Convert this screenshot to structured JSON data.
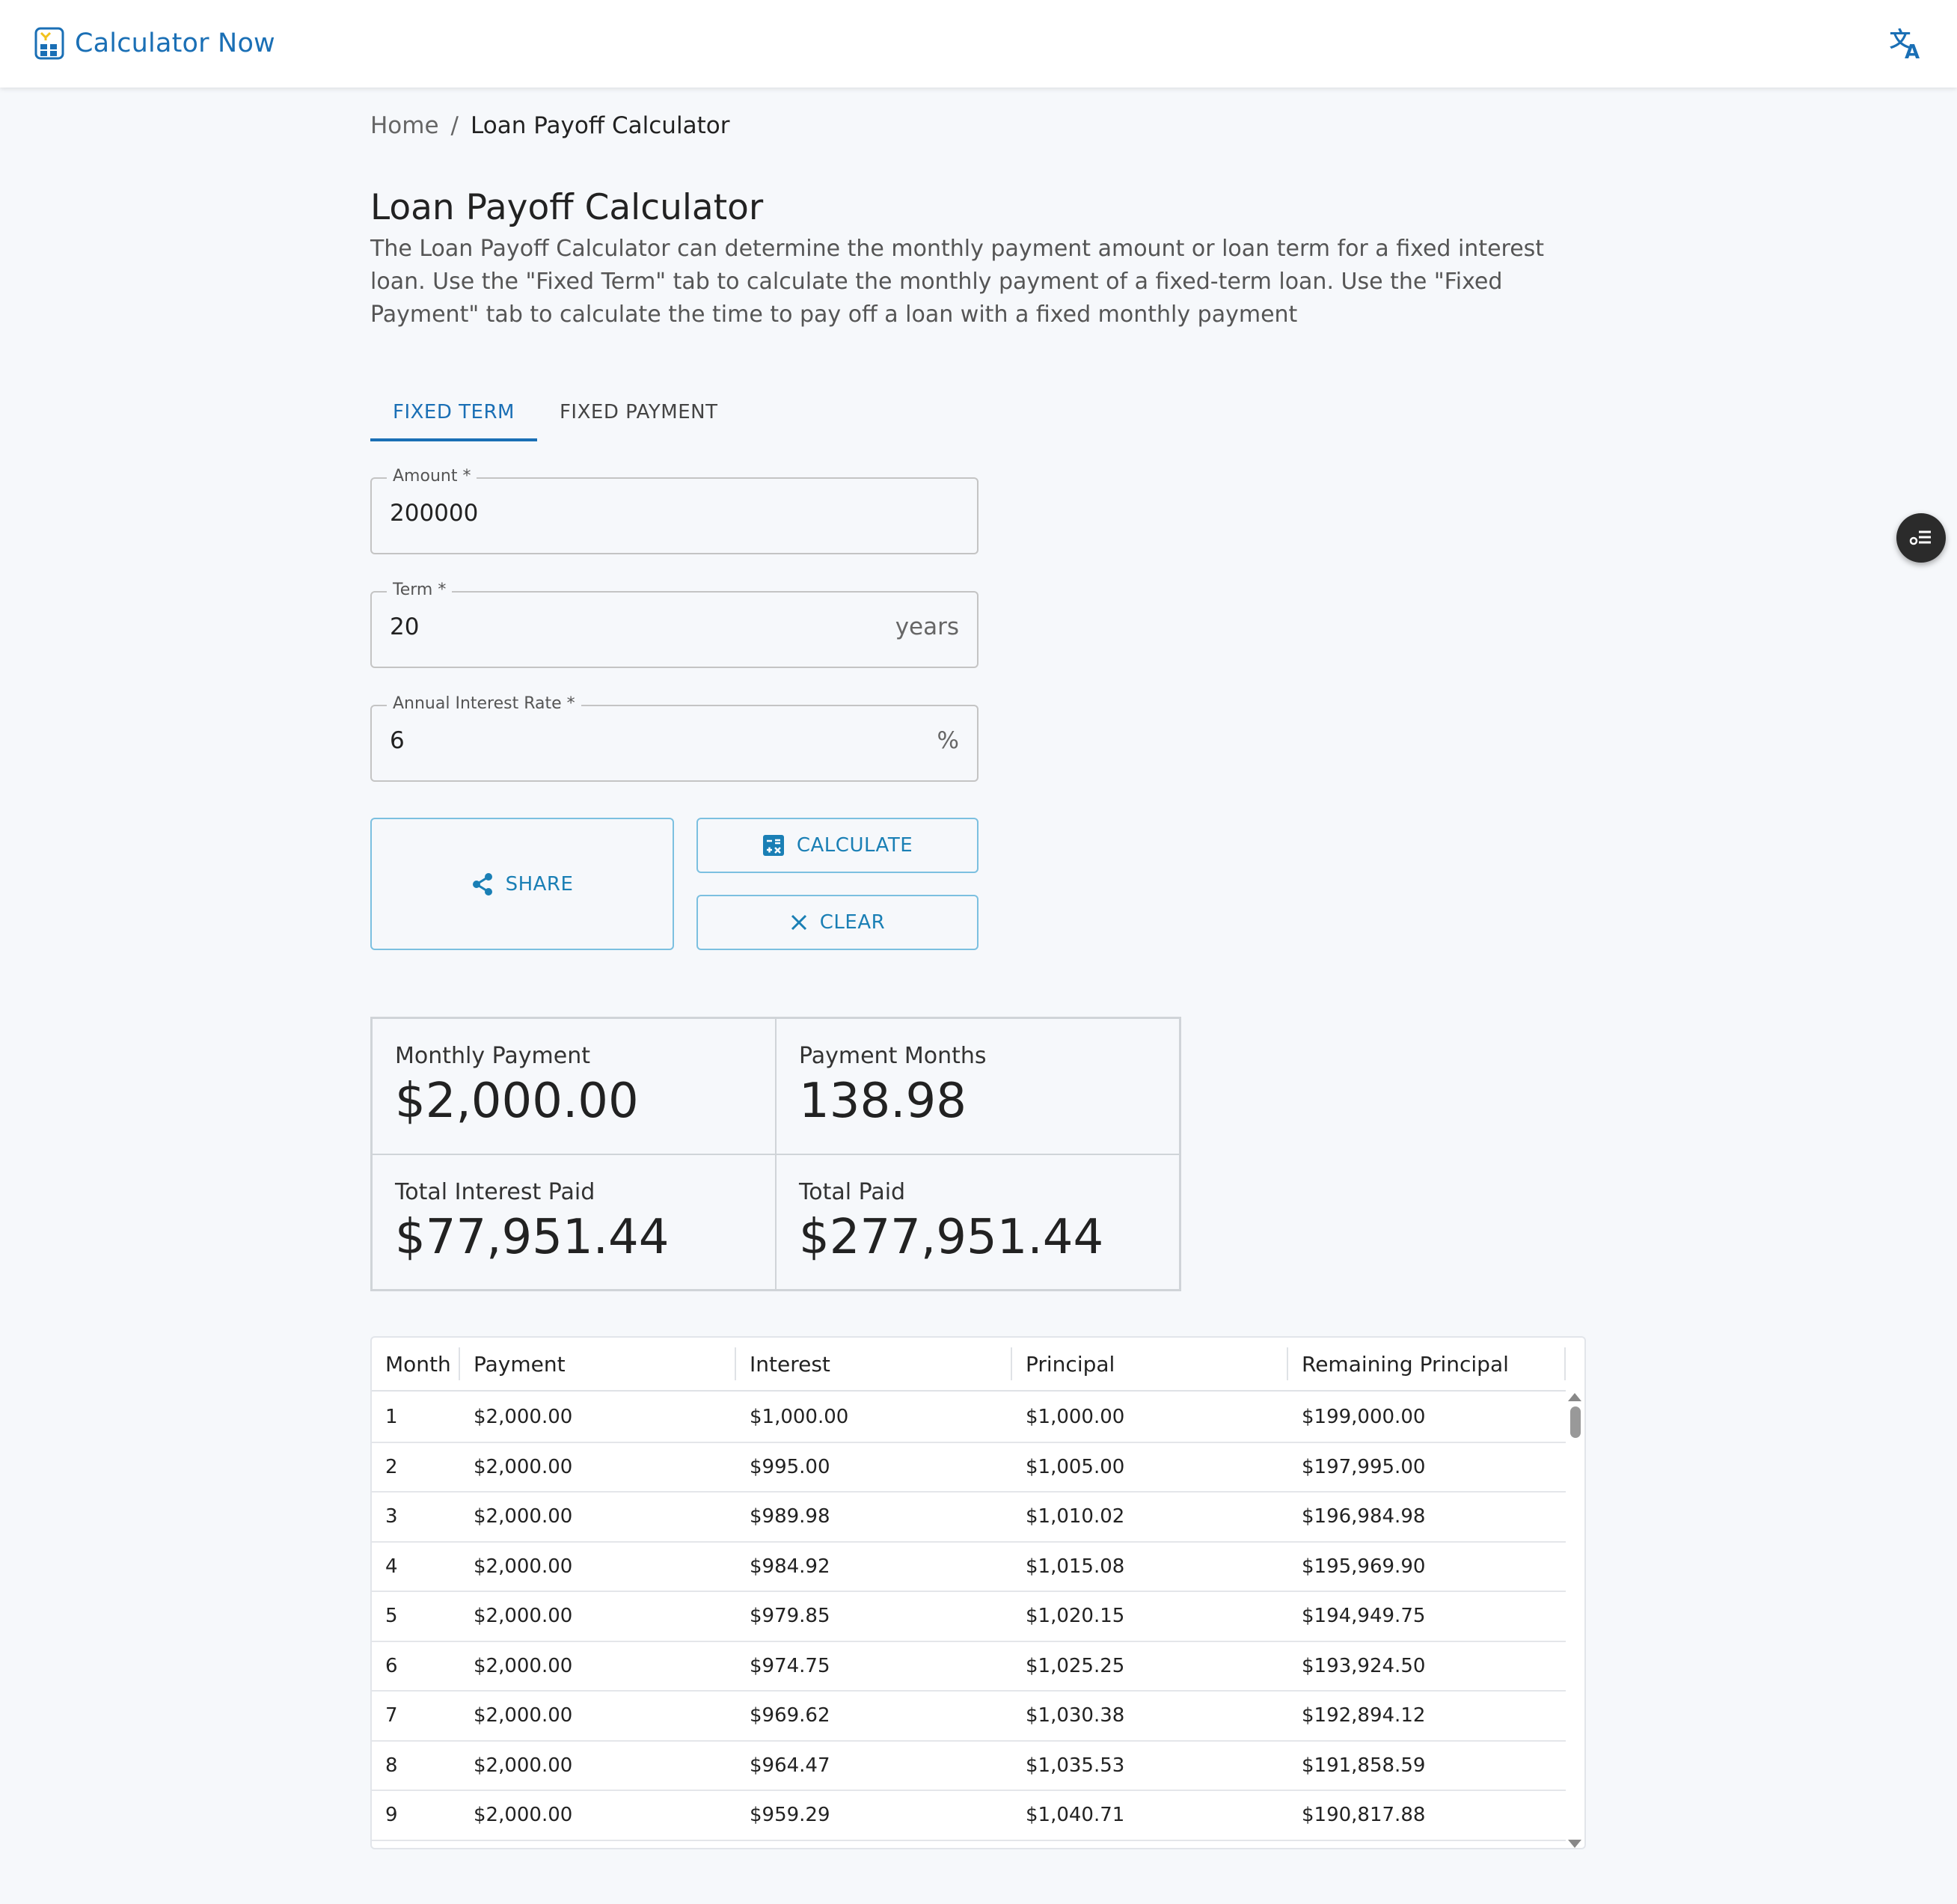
{
  "app": {
    "name": "Calculator Now",
    "accent": "#1a6fb5",
    "icons": [
      "calculator-logo-icon",
      "translate-icon",
      "share-icon",
      "calculator-icon",
      "close-icon",
      "toc-icon"
    ]
  },
  "breadcrumb": {
    "home": "Home",
    "separator": "/",
    "current": "Loan Payoff Calculator"
  },
  "page": {
    "title": "Loan Payoff Calculator",
    "description": "The Loan Payoff Calculator can determine the monthly payment amount or loan term for a fixed interest loan. Use the \"Fixed Term\" tab to calculate the monthly payment of a fixed-term loan. Use the \"Fixed Payment\" tab to calculate the time to pay off a loan with a fixed monthly payment"
  },
  "tabs": [
    {
      "label": "FIXED TERM",
      "active": true
    },
    {
      "label": "FIXED PAYMENT",
      "active": false
    }
  ],
  "form": {
    "amount": {
      "label": "Amount *",
      "value": "200000"
    },
    "term": {
      "label": "Term *",
      "value": "20",
      "suffix": "years"
    },
    "rate": {
      "label": "Annual Interest Rate *",
      "value": "6",
      "suffix": "%"
    }
  },
  "buttons": {
    "share": "SHARE",
    "calculate": "CALCULATE",
    "clear": "CLEAR"
  },
  "results": {
    "monthly_payment": {
      "label": "Monthly Payment",
      "value": "$2,000.00"
    },
    "payment_months": {
      "label": "Payment Months",
      "value": "138.98"
    },
    "total_interest": {
      "label": "Total Interest Paid",
      "value": "$77,951.44"
    },
    "total_paid": {
      "label": "Total Paid",
      "value": "$277,951.44"
    }
  },
  "table": {
    "headers": [
      "Month",
      "Payment",
      "Interest",
      "Principal",
      "Remaining Principal"
    ],
    "rows": [
      [
        "1",
        "$2,000.00",
        "$1,000.00",
        "$1,000.00",
        "$199,000.00"
      ],
      [
        "2",
        "$2,000.00",
        "$995.00",
        "$1,005.00",
        "$197,995.00"
      ],
      [
        "3",
        "$2,000.00",
        "$989.98",
        "$1,010.02",
        "$196,984.98"
      ],
      [
        "4",
        "$2,000.00",
        "$984.92",
        "$1,015.08",
        "$195,969.90"
      ],
      [
        "5",
        "$2,000.00",
        "$979.85",
        "$1,020.15",
        "$194,949.75"
      ],
      [
        "6",
        "$2,000.00",
        "$974.75",
        "$1,025.25",
        "$193,924.50"
      ],
      [
        "7",
        "$2,000.00",
        "$969.62",
        "$1,030.38",
        "$192,894.12"
      ],
      [
        "8",
        "$2,000.00",
        "$964.47",
        "$1,035.53",
        "$191,858.59"
      ],
      [
        "9",
        "$2,000.00",
        "$959.29",
        "$1,040.71",
        "$190,817.88"
      ]
    ]
  }
}
